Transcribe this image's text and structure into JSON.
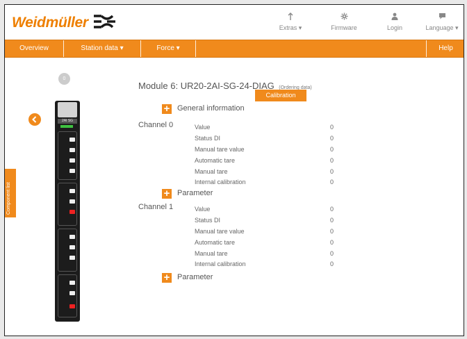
{
  "header": {
    "brand": "Weidmüller",
    "menu": [
      {
        "label": "Extras",
        "icon": "wrench-icon",
        "caret": "▾"
      },
      {
        "label": "Firmware",
        "icon": "gear-icon",
        "caret": ""
      },
      {
        "label": "Login",
        "icon": "user-icon",
        "caret": ""
      },
      {
        "label": "Language",
        "icon": "speech-bubble-icon",
        "caret": "▾"
      }
    ]
  },
  "nav": {
    "items": [
      {
        "label": "Overview",
        "caret": ""
      },
      {
        "label": "Station data",
        "caret": "▾"
      },
      {
        "label": "Force",
        "caret": "▾"
      }
    ],
    "help": "Help"
  },
  "sidebar": {
    "component_list_label": "Component list",
    "back_icon": "chevron-left-icon",
    "station_dot": "0",
    "device_label": "2AI SG"
  },
  "module": {
    "title": "Module 6: UR20-2AI-SG-24-DIAG",
    "ordering_data": "(Ordering data)",
    "calibration_button": "Calibration"
  },
  "sections": {
    "general_information": "General information",
    "parameter_0": "Parameter",
    "parameter_1": "Parameter"
  },
  "channels": [
    {
      "name": "Channel 0",
      "rows": [
        {
          "label": "Value",
          "value": "0"
        },
        {
          "label": "Status DI",
          "value": "0"
        },
        {
          "label": "Manual tare value",
          "value": "0"
        },
        {
          "label": "Automatic tare",
          "value": "0"
        },
        {
          "label": "Manual tare",
          "value": "0"
        },
        {
          "label": "Internal calibration",
          "value": "0"
        }
      ]
    },
    {
      "name": "Channel 1",
      "rows": [
        {
          "label": "Value",
          "value": "0"
        },
        {
          "label": "Status DI",
          "value": "0"
        },
        {
          "label": "Manual tare value",
          "value": "0"
        },
        {
          "label": "Automatic tare",
          "value": "0"
        },
        {
          "label": "Manual tare",
          "value": "0"
        },
        {
          "label": "Internal calibration",
          "value": "0"
        }
      ]
    }
  ],
  "colors": {
    "accent": "#f08a1c",
    "text": "#555555",
    "device": "#1c1c1c"
  }
}
